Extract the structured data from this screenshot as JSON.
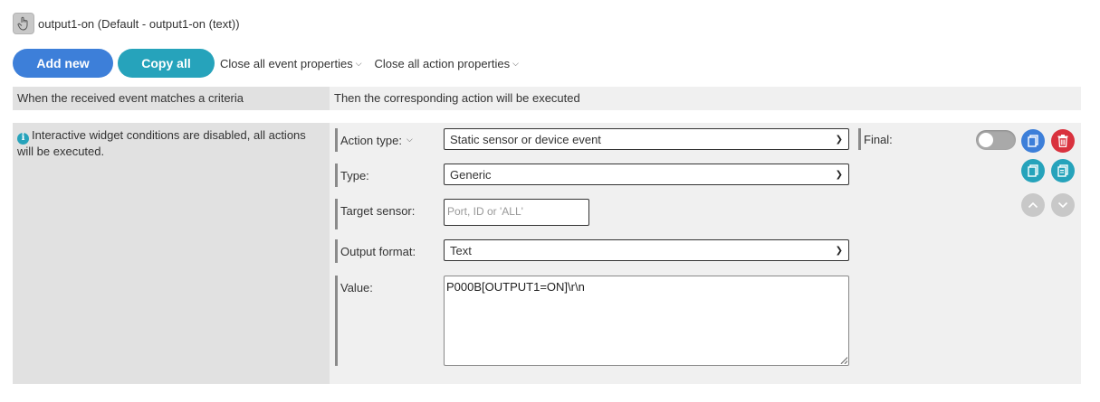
{
  "header": {
    "title": "output1-on (Default - output1-on (text))",
    "icon": "hand-pointer-icon"
  },
  "toolbar": {
    "add_new_label": "Add new",
    "copy_all_label": "Copy all",
    "close_event_label": "Close all event properties",
    "close_action_label": "Close all action properties"
  },
  "columns": {
    "left_header": "When the received event matches a criteria",
    "right_header": "Then the corresponding action will be executed"
  },
  "criteria": {
    "message": "Interactive widget conditions are disabled, all actions will be executed."
  },
  "action": {
    "action_type_label": "Action type:",
    "action_type_value": "Static sensor or device event",
    "type_label": "Type:",
    "type_value": "Generic",
    "target_sensor_label": "Target sensor:",
    "target_sensor_placeholder": "Port, ID or 'ALL'",
    "output_format_label": "Output format:",
    "output_format_value": "Text",
    "value_label": "Value:",
    "value_text": "P000B[OUTPUT1=ON]\\r\\n",
    "final_label": "Final:"
  },
  "colors": {
    "primary_blue": "#3d7fd9",
    "teal": "#26a3bb",
    "danger_red": "#d9323e",
    "toggle_off": "#a9a9a9"
  }
}
